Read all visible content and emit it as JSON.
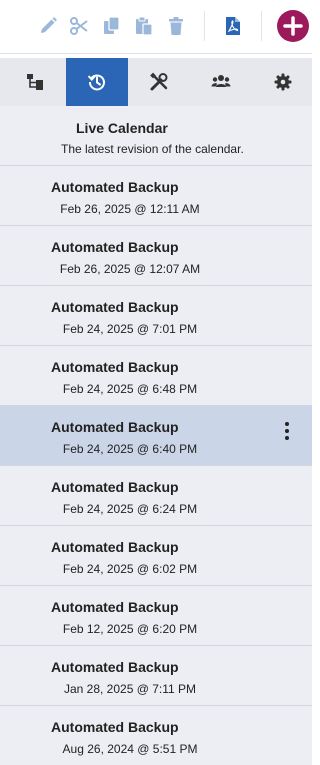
{
  "colors": {
    "toolbar_icon": "#9bb8d9",
    "pdf_icon": "#2b65b5",
    "add_button": "#9c1a5c",
    "tab_active": "#2b65b5",
    "tab_bg": "#e6e8ed",
    "list_bg": "#eceef3",
    "selected_row": "#cbd5e8"
  },
  "toolbar": {
    "icons": [
      "pencil-icon",
      "scissors-icon",
      "copy-icon",
      "paste-icon",
      "trash-icon",
      "pdf-icon",
      "plus-icon"
    ]
  },
  "tabs": [
    {
      "icon": "tree-icon",
      "active": false
    },
    {
      "icon": "history-icon",
      "active": true
    },
    {
      "icon": "tools-icon",
      "active": false
    },
    {
      "icon": "users-icon",
      "active": false
    },
    {
      "icon": "gear-icon",
      "active": false
    }
  ],
  "live": {
    "title": "Live Calendar",
    "subtitle": "The latest revision of the calendar."
  },
  "revisions": [
    {
      "title": "Automated Backup",
      "date": "Feb 26, 2025 @ 12:11 AM"
    },
    {
      "title": "Automated Backup",
      "date": "Feb 26, 2025 @ 12:07 AM"
    },
    {
      "title": "Automated Backup",
      "date": "Feb 24, 2025 @ 7:01 PM"
    },
    {
      "title": "Automated Backup",
      "date": "Feb 24, 2025 @ 6:48 PM"
    },
    {
      "title": "Automated Backup",
      "date": "Feb 24, 2025 @ 6:40 PM",
      "selected": true
    },
    {
      "title": "Automated Backup",
      "date": "Feb 24, 2025 @ 6:24 PM"
    },
    {
      "title": "Automated Backup",
      "date": "Feb 24, 2025 @ 6:02 PM"
    },
    {
      "title": "Automated Backup",
      "date": "Feb 12, 2025 @ 6:20 PM"
    },
    {
      "title": "Automated Backup",
      "date": "Jan 28, 2025 @ 7:11 PM"
    },
    {
      "title": "Automated Backup",
      "date": "Aug 26, 2024 @ 5:51 PM"
    }
  ]
}
